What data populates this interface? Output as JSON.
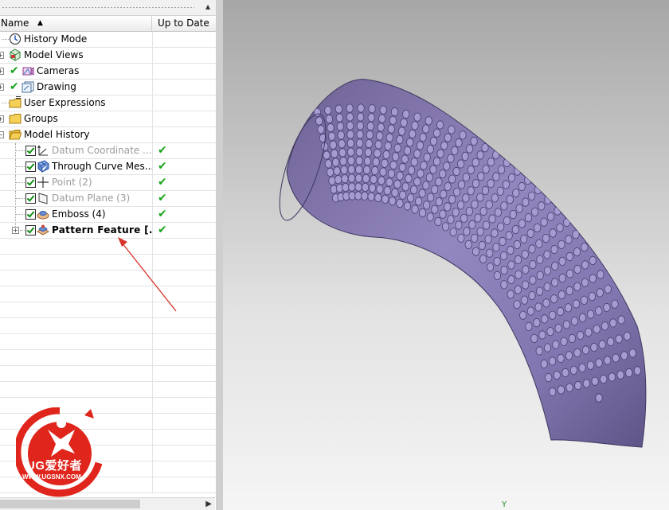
{
  "navigator": {
    "columns": {
      "name": "Name",
      "sort_glyph": "▲",
      "up_to_date": "Up to Date"
    },
    "close_glyph": "▴",
    "up_to_date_glyph": "✔",
    "rows": [
      {
        "label": "History Mode",
        "icon": "clock-icon",
        "expandable": false,
        "visibility_check": false,
        "style": "normal"
      },
      {
        "label": "Model Views",
        "icon": "model-views-icon",
        "expandable": true,
        "visibility_check": false,
        "style": "normal"
      },
      {
        "label": "Cameras",
        "icon": "camera-icon",
        "expandable": true,
        "visibility_check": true,
        "style": "normal"
      },
      {
        "label": "Drawing",
        "icon": "drawing-icon",
        "expandable": true,
        "visibility_check": true,
        "style": "normal"
      },
      {
        "label": "User Expressions",
        "icon": "folder-expressions-icon",
        "expandable": false,
        "visibility_check": false,
        "style": "normal"
      },
      {
        "label": "Groups",
        "icon": "folder-icon",
        "expandable": true,
        "visibility_check": false,
        "style": "normal"
      },
      {
        "label": "Model History",
        "icon": "folder-open-icon",
        "expandable": false,
        "visibility_check": false,
        "style": "normal"
      },
      {
        "label": "Datum Coordinate ...",
        "icon": "datum-csys-icon",
        "checkbox": true,
        "style": "dim",
        "up_to_date": true
      },
      {
        "label": "Through Curve Mes...",
        "icon": "mesh-surface-icon",
        "checkbox": true,
        "style": "normal",
        "up_to_date": true
      },
      {
        "label": "Point (2)",
        "icon": "point-icon",
        "checkbox": true,
        "style": "dim",
        "up_to_date": true
      },
      {
        "label": "Datum Plane (3)",
        "icon": "datum-plane-icon",
        "checkbox": true,
        "style": "dim",
        "up_to_date": true
      },
      {
        "label": "Emboss (4)",
        "icon": "emboss-icon",
        "checkbox": true,
        "style": "normal",
        "up_to_date": true
      },
      {
        "label": "Pattern Feature [...",
        "icon": "pattern-feature-icon",
        "checkbox": true,
        "style": "bold",
        "expandable": true,
        "up_to_date": true
      }
    ]
  },
  "viewport": {
    "axis_label": "Y",
    "model_color": "#8b7fb3"
  },
  "logo": {
    "text": "UG爱好者",
    "url": "WWW.UGSNX.COM",
    "color": "#e0261c"
  },
  "annotation": {
    "color": "#d9322a"
  }
}
